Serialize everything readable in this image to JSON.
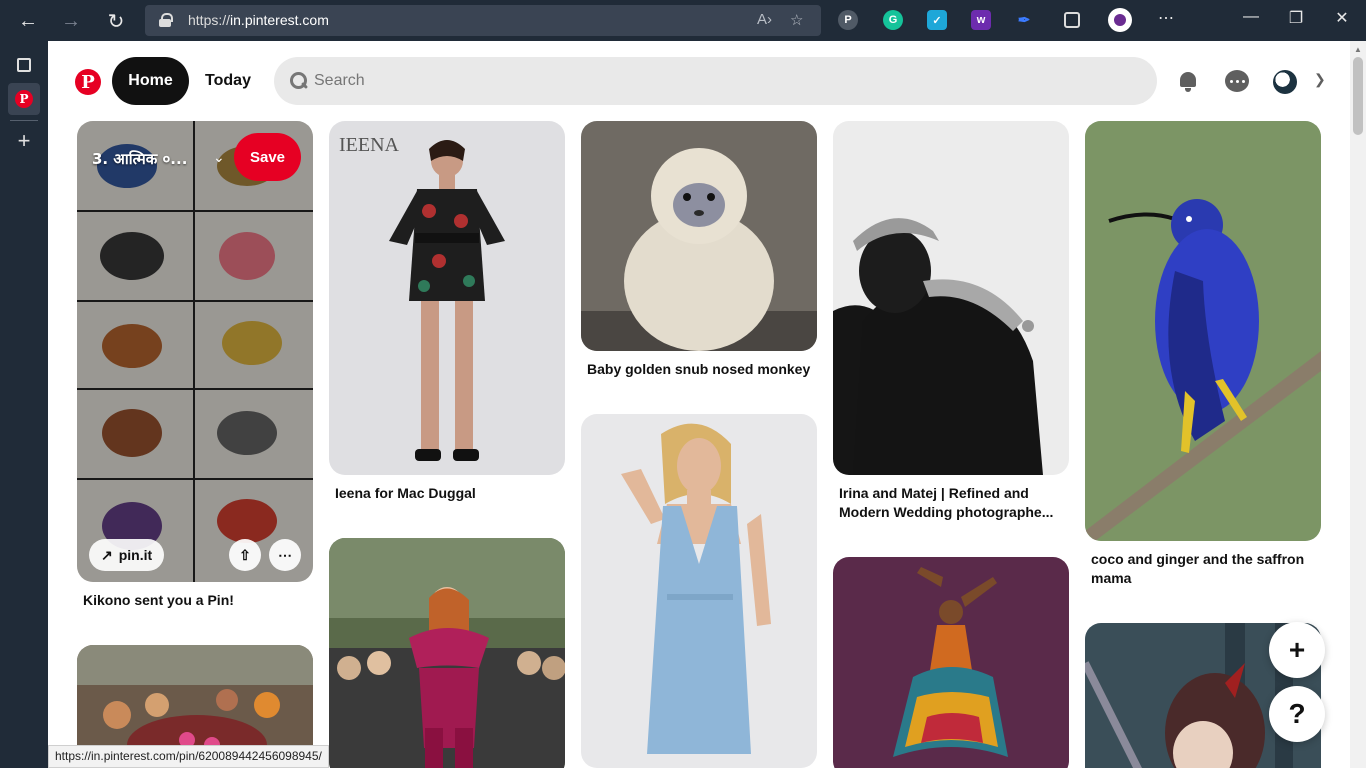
{
  "browser": {
    "url_prefix": "https://",
    "url_host": "in.pinterest.com",
    "status_url": "https://in.pinterest.com/pin/620089442456098945/"
  },
  "header": {
    "home_label": "Home",
    "today_label": "Today",
    "search_placeholder": "Search"
  },
  "pins": [
    {
      "title": "Kikono sent you a Pin!",
      "board": "3. आत्मिक ०...",
      "save_label": "Save",
      "link_label": "pin.it"
    },
    {
      "title": "Ieena for Mac Duggal",
      "image_text": "IEENA"
    },
    {
      "title": "Baby golden snub nosed monkey"
    },
    {
      "title_line1": "Irina and Matej | Refined and",
      "title_line2": "Modern Wedding photographe..."
    },
    {
      "title_line1": "coco and ginger and the saffron",
      "title_line2": "mama"
    }
  ],
  "fabs": {
    "add": "+",
    "help": "?"
  },
  "colors": {
    "brand": "#e60023",
    "browser_chrome": "#202b38"
  }
}
